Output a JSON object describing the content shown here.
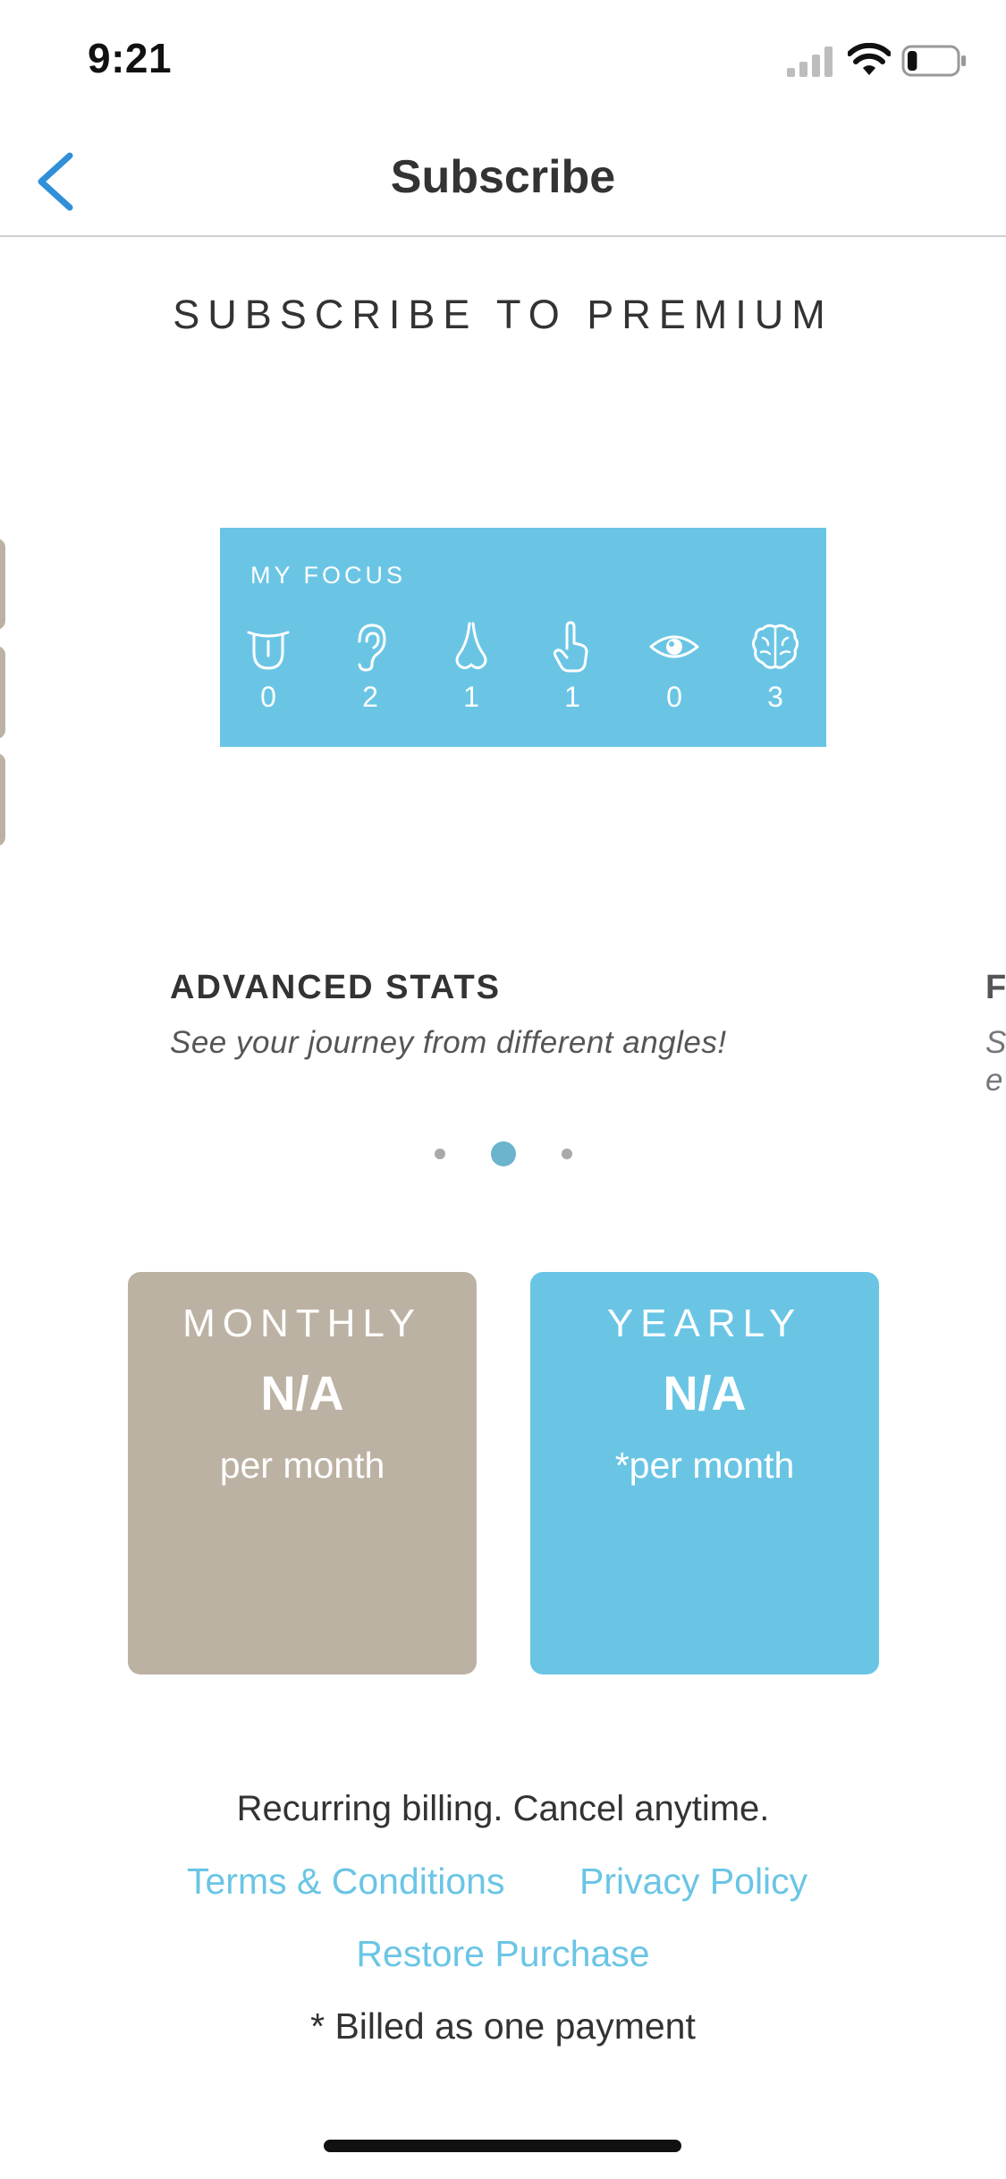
{
  "status_bar": {
    "time": "9:21",
    "battery_level": 0.2
  },
  "nav": {
    "title": "Subscribe",
    "back_icon": "chevron-left-icon"
  },
  "header": {
    "subtitle": "SUBSCRIBE TO PREMIUM"
  },
  "focus_card": {
    "title": "MY FOCUS",
    "items": [
      {
        "icon": "tongue-icon",
        "value": "0"
      },
      {
        "icon": "ear-icon",
        "value": "2"
      },
      {
        "icon": "nose-icon",
        "value": "1"
      },
      {
        "icon": "finger-touch-icon",
        "value": "1"
      },
      {
        "icon": "eye-icon",
        "value": "0"
      },
      {
        "icon": "brain-icon",
        "value": "3"
      }
    ]
  },
  "feature": {
    "title": "ADVANCED STATS",
    "description": "See your journey from different angles!",
    "next_title_peek": "F",
    "next_desc_peek_1": "S",
    "next_desc_peek_2": "e"
  },
  "pagination": {
    "count": 3,
    "active_index": 1
  },
  "plans": {
    "monthly": {
      "name": "MONTHLY",
      "price": "N/A",
      "unit": "per month"
    },
    "yearly": {
      "name": "YEARLY",
      "price": "N/A",
      "unit": "*per month"
    }
  },
  "footer": {
    "billing_note": "Recurring billing. Cancel anytime.",
    "terms_label": "Terms & Conditions",
    "privacy_label": "Privacy Policy",
    "restore_label": "Restore Purchase",
    "billed_note": "* Billed as one payment"
  },
  "colors": {
    "accent": "#6ac5e5",
    "monthly": "#bcb2a3",
    "link": "#6ac5e5",
    "back": "#2f8fd8"
  }
}
